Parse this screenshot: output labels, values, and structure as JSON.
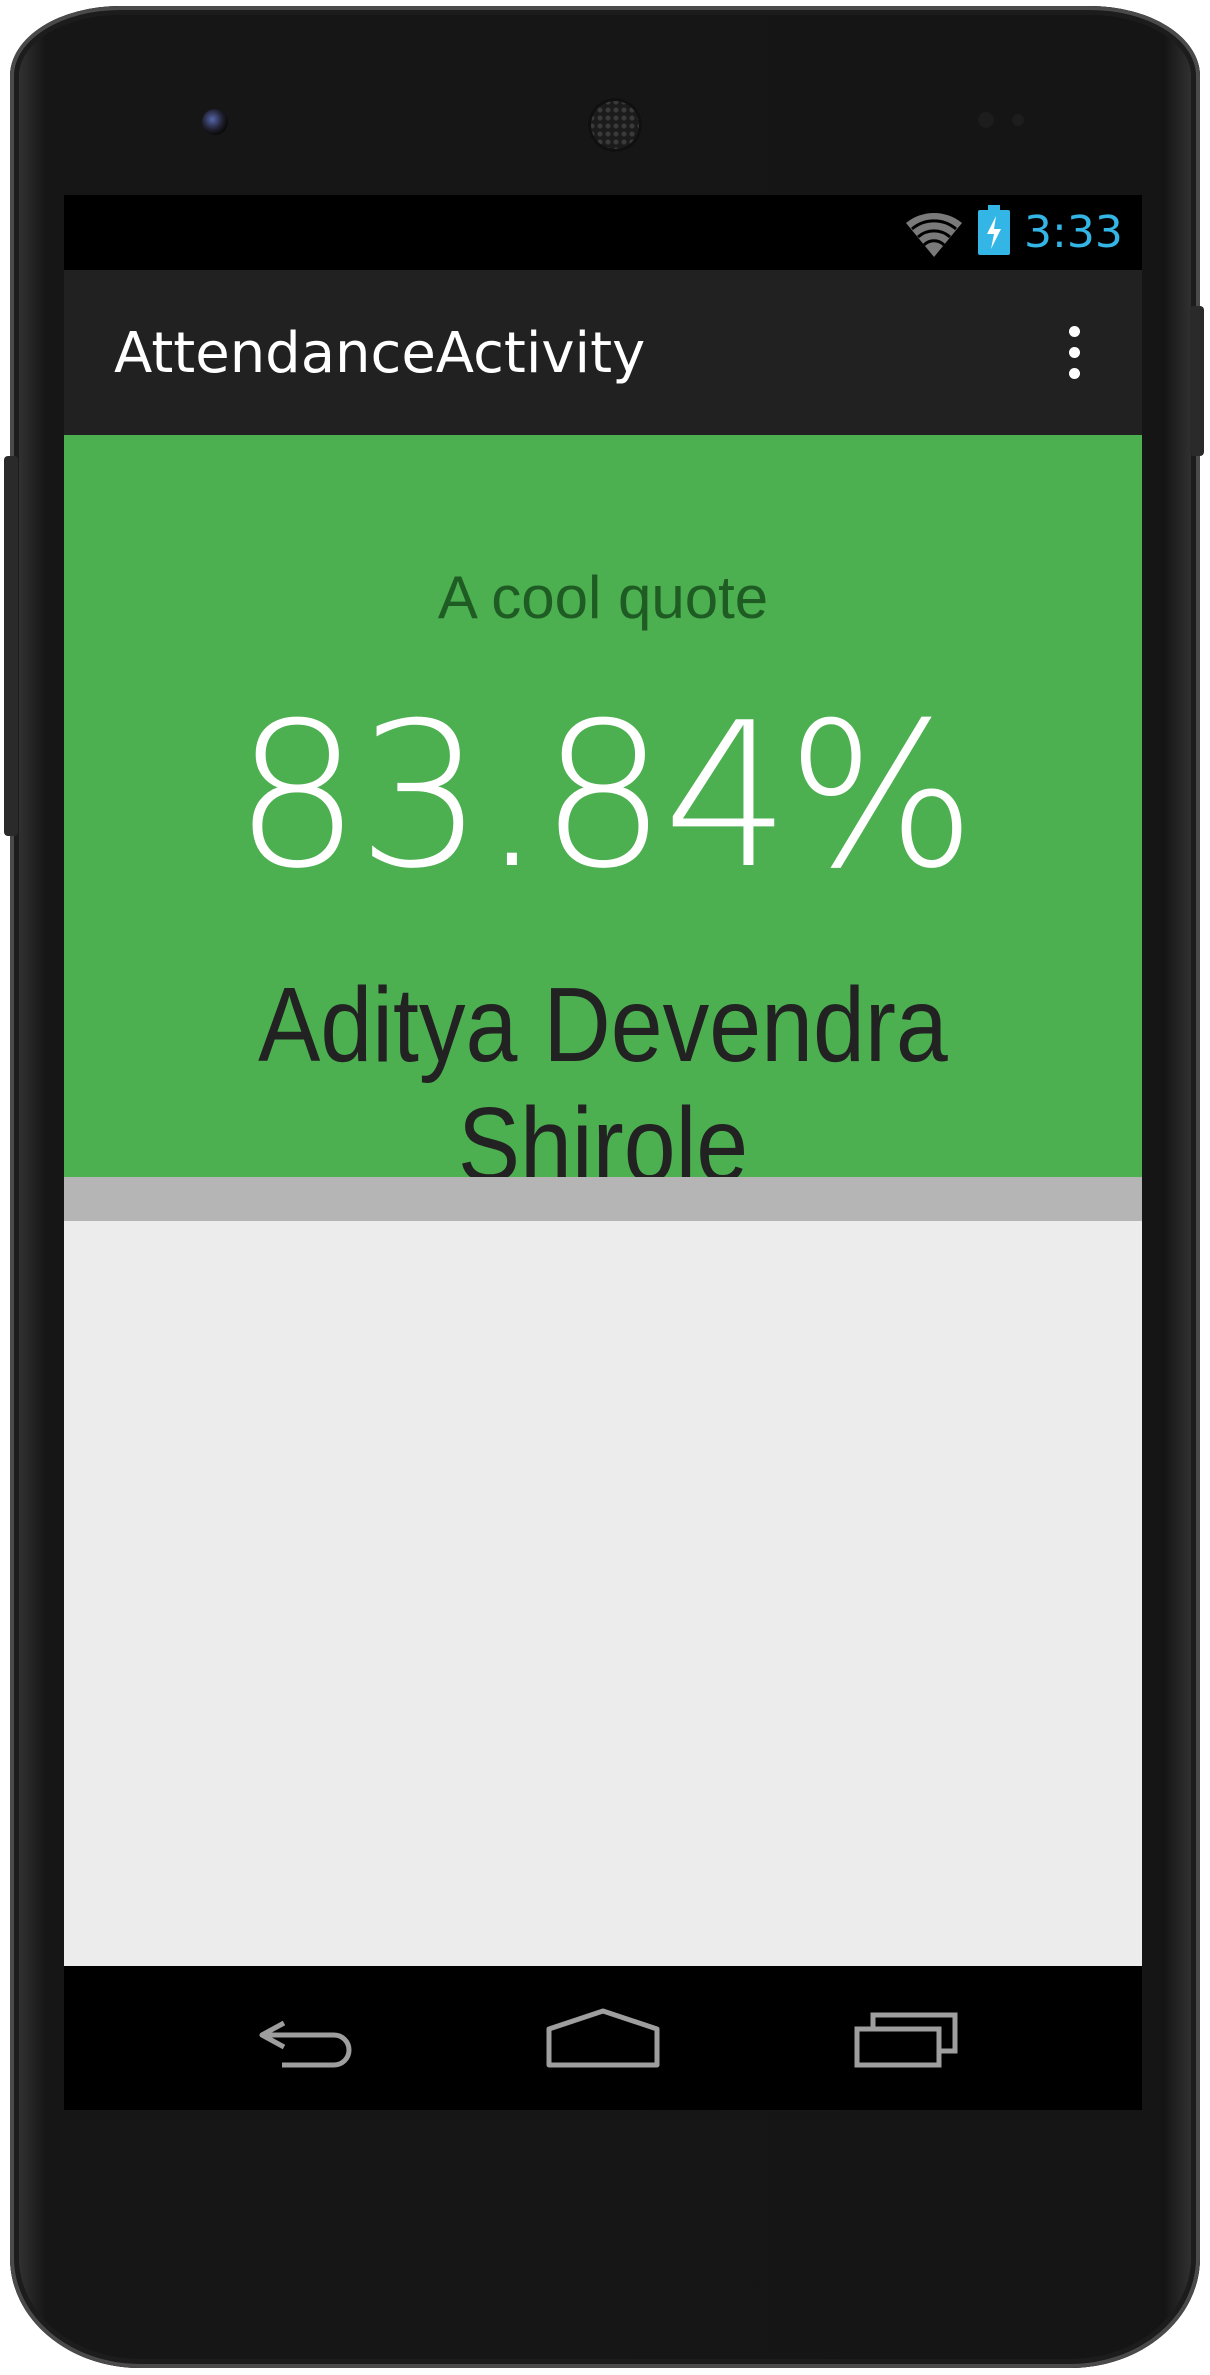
{
  "status_bar": {
    "time": "3:33",
    "icons": [
      "wifi-icon",
      "battery-charging-icon"
    ]
  },
  "action_bar": {
    "title": "AttendanceActivity",
    "overflow_icon": "more-vert-icon"
  },
  "attendance_card": {
    "quote": "A cool quote",
    "percentage": "83.84%",
    "student_name": "Aditya Devendra Shirole",
    "background_color": "#4caf50"
  },
  "nav_bar": {
    "icons": [
      "back-icon",
      "home-icon",
      "recents-icon"
    ]
  },
  "colors": {
    "accent": "#33b5e5",
    "action_bar": "#212121",
    "content_bg": "#ececec"
  }
}
